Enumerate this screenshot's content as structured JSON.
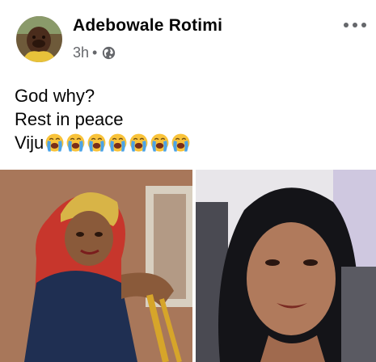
{
  "post": {
    "author": "Adebowale Rotimi",
    "time": "3h",
    "separator": "•",
    "privacy_icon": "globe-icon",
    "menu_icon": "more-options-icon",
    "lines": [
      "God why?",
      "Rest in peace",
      "Viju"
    ],
    "emoji_name": "loudly-crying-face-icon",
    "emoji_count": 7
  },
  "colors": {
    "text": "#050505",
    "secondary": "#65676b",
    "background": "#ffffff"
  }
}
